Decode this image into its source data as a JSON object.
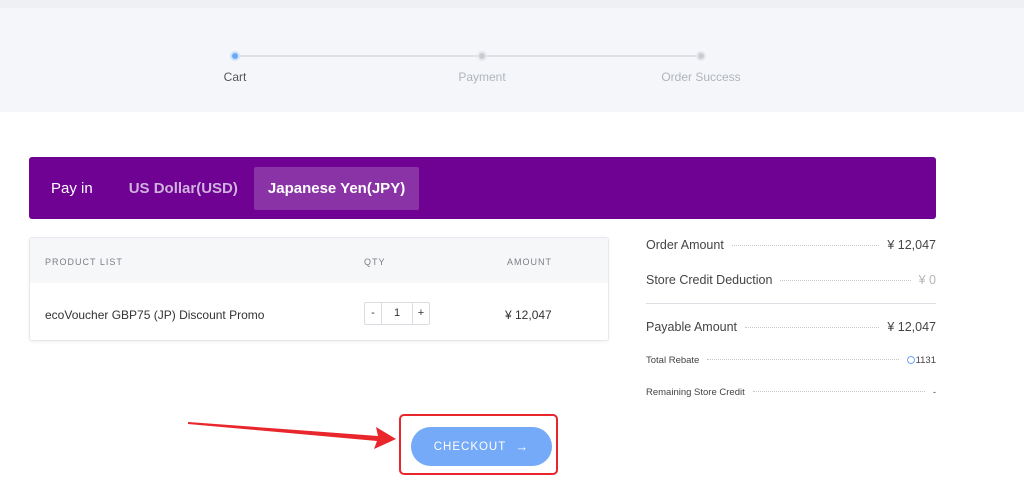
{
  "stepper": {
    "steps": [
      {
        "label": "Cart",
        "active": true
      },
      {
        "label": "Payment",
        "active": false
      },
      {
        "label": "Order Success",
        "active": false
      }
    ]
  },
  "payment": {
    "pay_in_label": "Pay in",
    "currencies": [
      {
        "label": "US Dollar(USD)",
        "selected": false
      },
      {
        "label": "Japanese Yen(JPY)",
        "selected": true
      }
    ]
  },
  "product_table": {
    "headers": {
      "product": "PRODUCT LIST",
      "qty": "QTY",
      "amount": "AMOUNT"
    },
    "rows": [
      {
        "name": "ecoVoucher GBP75 (JP) Discount Promo",
        "qty": "1",
        "amount": "¥ 12,047",
        "minus": "-",
        "plus": "+"
      }
    ]
  },
  "summary": {
    "order_amount_label": "Order Amount",
    "order_amount_value": "¥ 12,047",
    "store_credit_label": "Store Credit Deduction",
    "store_credit_value": "¥ 0",
    "payable_label": "Payable Amount",
    "payable_value": "¥ 12,047",
    "rebate_label": "Total Rebate",
    "rebate_value": "1131",
    "remaining_label": "Remaining Store Credit",
    "remaining_value": "-"
  },
  "checkout": {
    "label": "CHECKOUT",
    "arrow": "→"
  },
  "colors": {
    "brand_purple": "#6f0193",
    "accent_blue": "#74aaf7",
    "annotation_red": "#e8262b"
  }
}
